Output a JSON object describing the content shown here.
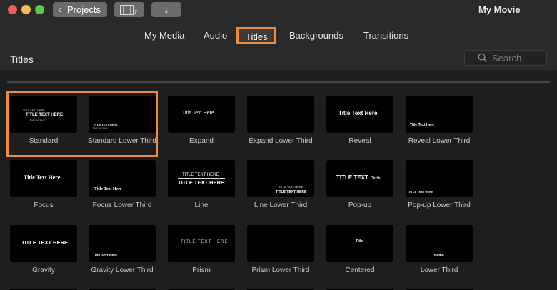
{
  "window": {
    "title": "My Movie",
    "projects_button": "Projects",
    "traffic_colors": {
      "close": "#ee5c52",
      "minimize": "#f5bd4f",
      "zoom": "#5fc454"
    }
  },
  "tabs": [
    {
      "label": "My Media",
      "active": false
    },
    {
      "label": "Audio",
      "active": false
    },
    {
      "label": "Titles",
      "active": true
    },
    {
      "label": "Backgrounds",
      "active": false
    },
    {
      "label": "Transitions",
      "active": false
    }
  ],
  "header": {
    "title": "Titles",
    "search_placeholder": "Search"
  },
  "accent_color": "#f08a3c",
  "titles": [
    {
      "name": "Standard",
      "preview": "TITLE TEXT HERE"
    },
    {
      "name": "Standard Lower Third",
      "preview": "TITLE TEXT HERE"
    },
    {
      "name": "Expand",
      "preview": "Title Text Here"
    },
    {
      "name": "Expand Lower Third",
      "preview": ""
    },
    {
      "name": "Reveal",
      "preview": "Title Text Here"
    },
    {
      "name": "Reveal Lower Third",
      "preview": "Title Text Here"
    },
    {
      "name": "Focus",
      "preview": "Title Text Here"
    },
    {
      "name": "Focus Lower Third",
      "preview": "Title Text Here"
    },
    {
      "name": "Line",
      "preview": "TITLE TEXT HERE"
    },
    {
      "name": "Line Lower Third",
      "preview": "TITLE TEXT HERE"
    },
    {
      "name": "Pop-up",
      "preview": "TITLE TEXT"
    },
    {
      "name": "Pop-up Lower Third",
      "preview": "TITLE TEXT HERE"
    },
    {
      "name": "Gravity",
      "preview": "TITLE TEXT HERE"
    },
    {
      "name": "Gravity Lower Third",
      "preview": "Title Text Here"
    },
    {
      "name": "Prism",
      "preview": "TITLE TEXT HERE"
    },
    {
      "name": "Prism Lower Third",
      "preview": ""
    },
    {
      "name": "Centered",
      "preview": "Title"
    },
    {
      "name": "Lower Third",
      "preview": "Name"
    }
  ]
}
